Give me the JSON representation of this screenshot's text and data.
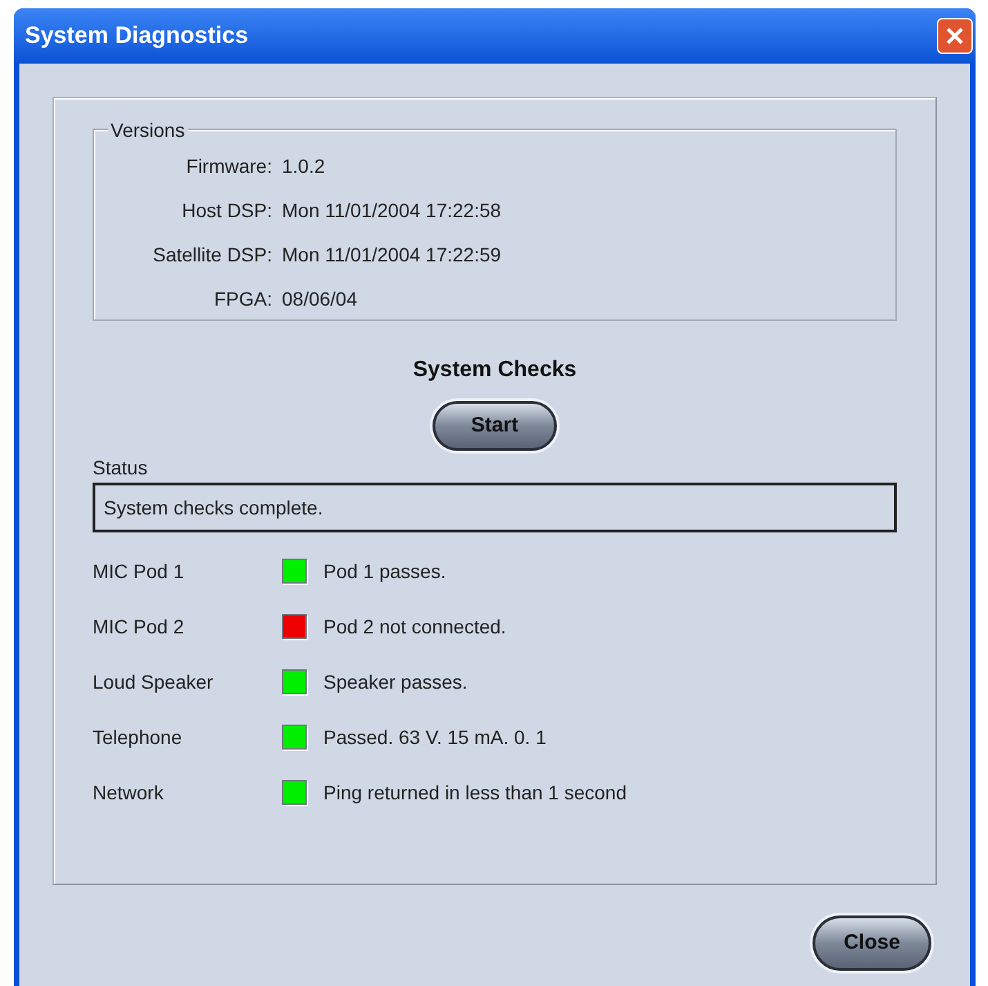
{
  "window": {
    "title": "System Diagnostics"
  },
  "versions": {
    "title": "Versions",
    "rows": [
      {
        "label": "Firmware:",
        "value": "1.0.2"
      },
      {
        "label": "Host DSP:",
        "value": "Mon 11/01/2004 17:22:58"
      },
      {
        "label": "Satellite DSP:",
        "value": "Mon 11/01/2004 17:22:59"
      },
      {
        "label": "FPGA:",
        "value": "08/06/04"
      }
    ]
  },
  "system_checks": {
    "title": "System Checks",
    "start_button": "Start",
    "status_label": "Status",
    "status": "System checks complete.",
    "checks": [
      {
        "name": "MIC Pod 1",
        "color": "#00ee00",
        "result": "Pod 1 passes."
      },
      {
        "name": "MIC Pod 2",
        "color": "#ee0000",
        "result": "Pod 2 not connected."
      },
      {
        "name": "Loud Speaker",
        "color": "#00ee00",
        "result": "Speaker passes."
      },
      {
        "name": "Telephone",
        "color": "#00ee00",
        "result": "Passed. 63 V. 15 mA. 0. 1"
      },
      {
        "name": "Network",
        "color": "#00ee00",
        "result": "Ping returned in less than 1 second"
      }
    ]
  },
  "close_button": "Close"
}
